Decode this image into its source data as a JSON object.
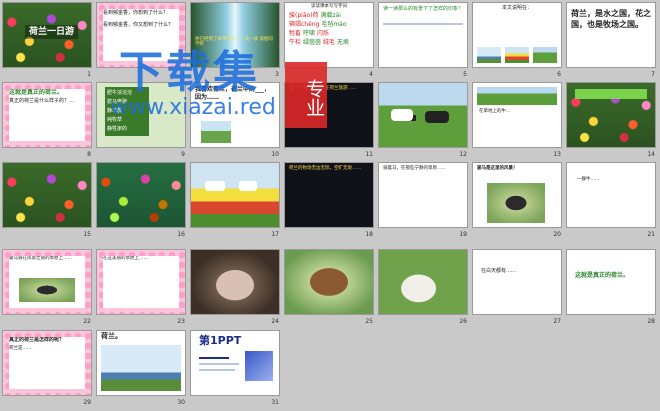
{
  "thumbnails": {
    "numbers": [
      "1",
      "2",
      "3",
      "4",
      "5",
      "6",
      "7",
      "8",
      "9",
      "10",
      "11",
      "12",
      "13",
      "14",
      "15",
      "16",
      "17",
      "18",
      "19",
      "20",
      "21",
      "22",
      "23",
      "24",
      "25",
      "26",
      "27",
      "28",
      "29",
      "30",
      "31"
    ]
  },
  "slides": {
    "s1": {
      "title": "荷兰一日游"
    },
    "s2": {
      "q1": "看到郁金香，你想到了什么？",
      "q2": "看到郁金香，你又想到了什么？"
    },
    "s3": {
      "text": "你已经到了本课学习……读一读 读给同学听"
    },
    "s4": {
      "head": "读读课本写写字词",
      "w1": "骏(piāo)荷",
      "w2": "满载zài",
      "w3": "辆竭chěng",
      "w4": "毛毡máo",
      "w5": "牲畜",
      "w6": "呼啸",
      "w7": "闪烁",
      "w8": "牛栏",
      "w9": "绿茵茵",
      "w10": "绒毛",
      "w11": "无垠"
    },
    "s5": {
      "text": "读一读那么的有景下了怎样的印象？"
    },
    "s6": {
      "head": "本文说明在："
    },
    "s7": {
      "text": "荷兰，是水之国，花之国，也是牧场之国。"
    },
    "s8": {
      "title": "这就是真正的荷兰。",
      "body": "真正的荷兰是什么样子的？…"
    },
    "s9": {
      "items": [
        "肥牛浓溶溶",
        "碧马奔驰",
        "静羊群",
        "纯牧草",
        "静牲家的"
      ]
    },
    "s10": {
      "text": "我喜欢荷兰，荷兰中的___，因为……"
    },
    "s11": {
      "text": "当一个荷兰的游人在荷兰旅游……"
    },
    "s13": {
      "text": "在草地上的牛..."
    },
    "s18": {
      "text": "荷兰的牧场无边无际，空旷无垠……"
    },
    "s19": {
      "text": "骑着马，在那些宁静的草原……"
    },
    "s20": {
      "text": "骏马是这里的风景！"
    },
    "s21": {
      "text": "一群牛……"
    },
    "s22": {
      "text": "骏马骑在风景壮丽的草原上……"
    },
    "s23": {
      "text": "在这美丽的草原上……"
    },
    "s27": {
      "text": "在白天都有……"
    },
    "s28": {
      "title": "这就是真正的荷兰。"
    },
    "s29": {
      "title": "真正的荷兰是怎样的呢？",
      "body": "荷兰是……"
    },
    "s30": {
      "title": "荷兰。"
    },
    "s31": {
      "title": "第1PPT"
    }
  },
  "watermark": {
    "big": "下载集",
    "url": "www.xiazai.red",
    "box": "专业"
  },
  "colors": {
    "background": "#c9c9c9",
    "slide_border": "#9a9a9a",
    "pink_frame": "#f9c6dc",
    "watermark_blue": "#1e6edc",
    "watermark_red": "#dc2828"
  }
}
